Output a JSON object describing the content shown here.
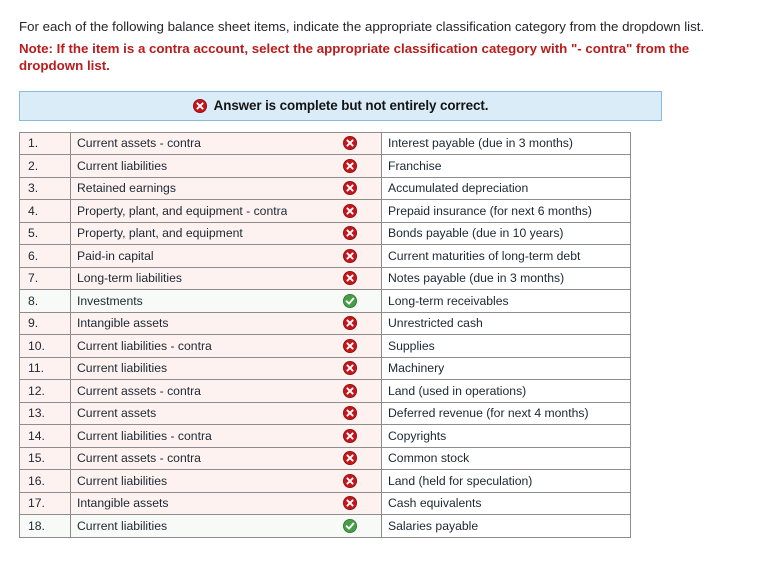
{
  "instructions": {
    "paragraph": "For each of the following balance sheet items, indicate the appropriate classification category from the dropdown list.",
    "note": "Note: If the item is a contra account, select the appropriate classification category with \"- contra\" from the dropdown list."
  },
  "banner": {
    "icon": "error-circle-icon",
    "text": "Answer is complete but not entirely correct.",
    "background_color": "#d9ecf8",
    "border_color": "#8bb9d8"
  },
  "colors": {
    "note_red": "#b81c1c",
    "wrong_row_background": "#fdf2f0",
    "right_row_background": "#f7faf6",
    "error_icon": "#c3161c",
    "success_icon": "#489e46",
    "table_border": "#8d8d8d"
  },
  "table": {
    "rows": [
      {
        "number": "1.",
        "answer": "Current assets - contra",
        "status": "incorrect",
        "item": "Interest payable (due in 3 months)"
      },
      {
        "number": "2.",
        "answer": "Current liabilities",
        "status": "incorrect",
        "item": "Franchise"
      },
      {
        "number": "3.",
        "answer": "Retained earnings",
        "status": "incorrect",
        "item": "Accumulated depreciation"
      },
      {
        "number": "4.",
        "answer": "Property, plant, and equipment - contra",
        "status": "incorrect",
        "item": "Prepaid insurance (for next 6 months)"
      },
      {
        "number": "5.",
        "answer": "Property, plant, and equipment",
        "status": "incorrect",
        "item": "Bonds payable (due in 10 years)"
      },
      {
        "number": "6.",
        "answer": "Paid-in capital",
        "status": "incorrect",
        "item": "Current maturities of long-term debt"
      },
      {
        "number": "7.",
        "answer": "Long-term liabilities",
        "status": "incorrect",
        "item": "Notes payable (due in 3 months)"
      },
      {
        "number": "8.",
        "answer": "Investments",
        "status": "correct",
        "item": "Long-term receivables"
      },
      {
        "number": "9.",
        "answer": "Intangible assets",
        "status": "incorrect",
        "item": "Unrestricted cash"
      },
      {
        "number": "10.",
        "answer": "Current liabilities - contra",
        "status": "incorrect",
        "item": "Supplies"
      },
      {
        "number": "11.",
        "answer": "Current liabilities",
        "status": "incorrect",
        "item": "Machinery"
      },
      {
        "number": "12.",
        "answer": "Current assets - contra",
        "status": "incorrect",
        "item": "Land (used in operations)"
      },
      {
        "number": "13.",
        "answer": "Current assets",
        "status": "incorrect",
        "item": "Deferred revenue (for next 4 months)"
      },
      {
        "number": "14.",
        "answer": "Current liabilities - contra",
        "status": "incorrect",
        "item": "Copyrights"
      },
      {
        "number": "15.",
        "answer": "Current assets - contra",
        "status": "incorrect",
        "item": "Common stock"
      },
      {
        "number": "16.",
        "answer": "Current liabilities",
        "status": "incorrect",
        "item": "Land (held for speculation)"
      },
      {
        "number": "17.",
        "answer": "Intangible assets",
        "status": "incorrect",
        "item": "Cash equivalents"
      },
      {
        "number": "18.",
        "answer": "Current liabilities",
        "status": "correct",
        "item": "Salaries payable"
      }
    ]
  }
}
